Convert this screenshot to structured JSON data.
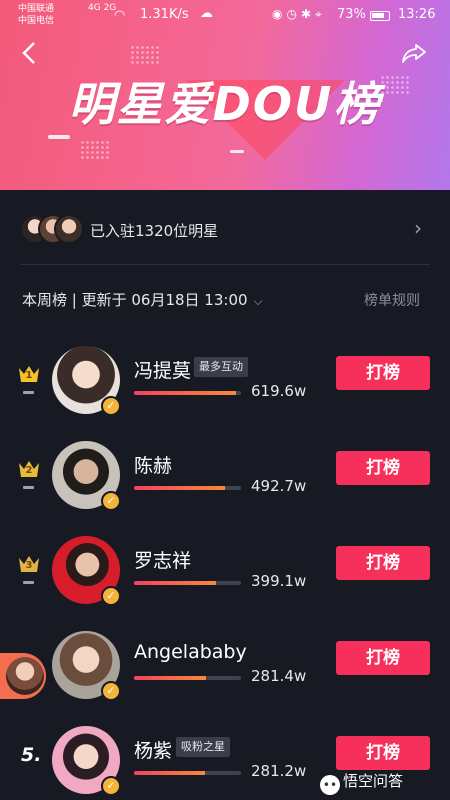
{
  "status_bar": {
    "carrier_1": "中国联通",
    "carrier_2": "中国电信",
    "network_1": "4G",
    "network_2": "2G",
    "speed": "1.31K/s",
    "battery": "73%",
    "time": "13:26"
  },
  "header": {
    "title": "明星爱DOU榜",
    "back_icon": "chevron-left-icon",
    "share_icon": "share-icon",
    "gradient": [
      "#f25a7a",
      "#d368d4",
      "#b277ea"
    ]
  },
  "joined": {
    "text": "已入驻1320位明星"
  },
  "list_header": {
    "period": "本周榜 | 更新于 06月18日 13:00",
    "rules": "榜单规则"
  },
  "vote_label": "打榜",
  "accent": "#f6305a",
  "rankings": [
    {
      "rank": "1",
      "name": "冯提莫",
      "tag": "最多互动",
      "score": "619.6w",
      "progress": 0.95
    },
    {
      "rank": "2",
      "name": "陈赫",
      "tag": "",
      "score": "492.7w",
      "progress": 0.85
    },
    {
      "rank": "3",
      "name": "罗志祥",
      "tag": "",
      "score": "399.1w",
      "progress": 0.77
    },
    {
      "rank": "",
      "name": "Angelababy",
      "tag": "",
      "score": "281.4w",
      "progress": 0.67
    },
    {
      "rank": "5.",
      "name": "杨紫",
      "tag": "吸粉之星",
      "score": "281.2w",
      "progress": 0.66
    }
  ],
  "watermark": {
    "text": "悟空问答"
  }
}
